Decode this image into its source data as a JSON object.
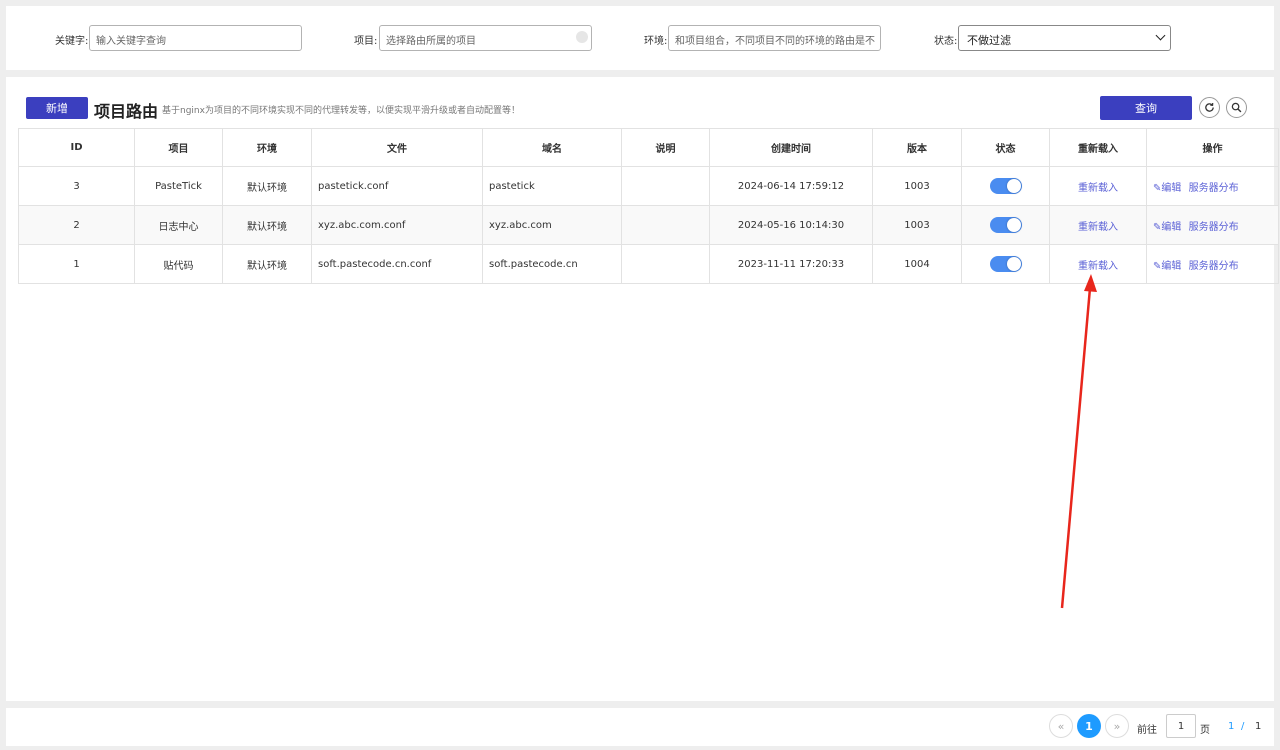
{
  "filters": {
    "keyword_label": "关键字:",
    "keyword_placeholder": "输入关键字查询",
    "project_label": "项目:",
    "project_placeholder": "选择路由所属的项目",
    "env_label": "环境:",
    "env_placeholder": "和项目组合，不同项目不同的环境的路由是不",
    "status_label": "状态:",
    "status_value": "不做过滤"
  },
  "toolbar": {
    "add_label": "新增",
    "title": "项目路由",
    "description": "基于nginx为项目的不同环境实现不同的代理转发等，以便实现平滑升级或者自动配置等！",
    "query_label": "查询",
    "refresh_icon": "refresh-icon",
    "search_icon": "search-icon"
  },
  "table": {
    "headers": [
      "ID",
      "项目",
      "环境",
      "文件",
      "域名",
      "说明",
      "创建时间",
      "版本",
      "状态",
      "重新载入",
      "操作"
    ],
    "rows": [
      {
        "id": "3",
        "project": "PasteTick",
        "env": "默认环境",
        "file": "pastetick.conf",
        "domain": "pastetick",
        "desc": "",
        "created": "2024-06-14 17:59:12",
        "version": "1003",
        "enabled": true,
        "reload": "重新载入",
        "edit": "编辑",
        "dist": "服务器分布"
      },
      {
        "id": "2",
        "project": "日志中心",
        "env": "默认环境",
        "file": "xyz.abc.com.conf",
        "domain": "xyz.abc.com",
        "desc": "",
        "created": "2024-05-16 10:14:30",
        "version": "1003",
        "enabled": true,
        "reload": "重新载入",
        "edit": "编辑",
        "dist": "服务器分布"
      },
      {
        "id": "1",
        "project": "贴代码",
        "env": "默认环境",
        "file": "soft.pastecode.cn.conf",
        "domain": "soft.pastecode.cn",
        "desc": "",
        "created": "2023-11-11 17:20:33",
        "version": "1004",
        "enabled": true,
        "reload": "重新载入",
        "edit": "编辑",
        "dist": "服务器分布"
      }
    ]
  },
  "pager": {
    "prev": "«",
    "current": "1",
    "next": "»",
    "goto_label": "前往",
    "goto_value": "1",
    "page_unit": "页",
    "page_info_current": "1",
    "page_info_sep": "/",
    "page_info_total": "1"
  },
  "colors": {
    "accent": "#3b3fbf",
    "link": "#5b61d6",
    "toggle_on": "#4a8cf0",
    "pager_active": "#1e9bff",
    "annotation_arrow": "#e8261c"
  }
}
